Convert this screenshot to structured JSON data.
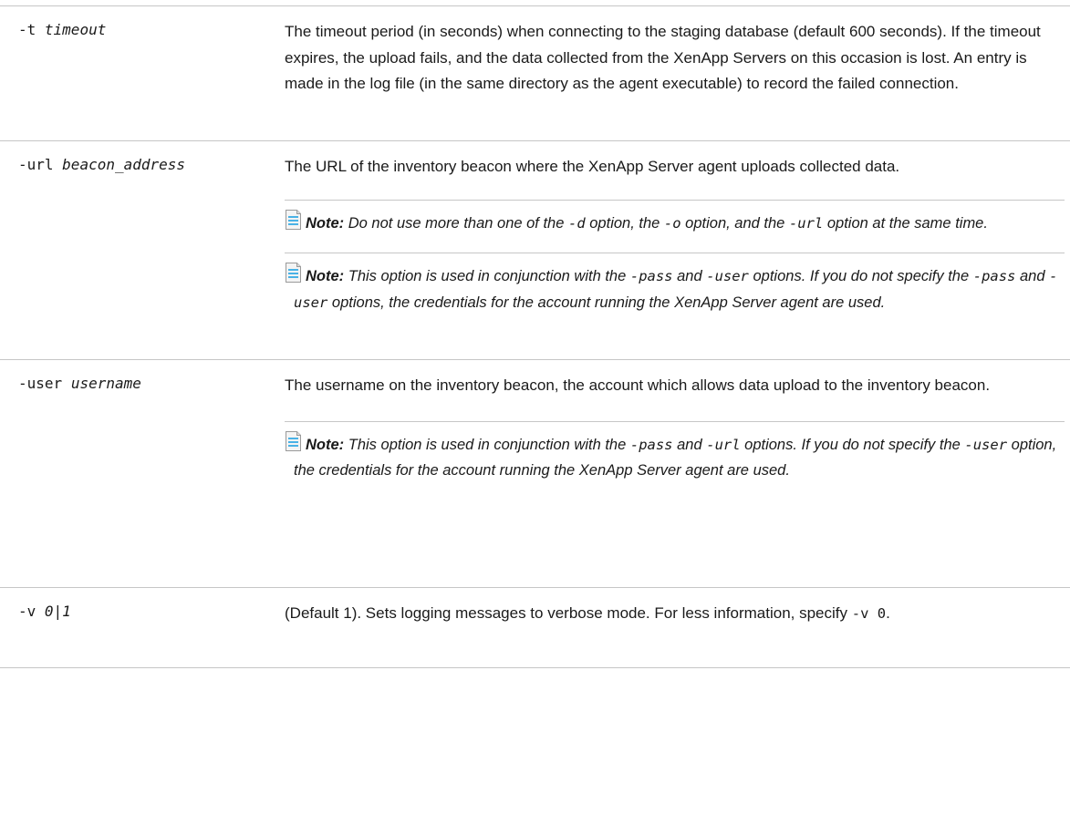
{
  "rows": [
    {
      "flag": "-t",
      "arg": "timeout",
      "desc": "The timeout period (in seconds) when connecting to the staging database (default 600 seconds). If the timeout expires, the upload fails, and the data collected from the XenApp Servers on this occasion is lost. An entry is made in the log file (in the same directory as the agent executable) to record the failed connection."
    },
    {
      "flag": "-url",
      "arg": "beacon_address",
      "desc": "The URL of the inventory beacon where the XenApp Server agent uploads collected data.",
      "notes": [
        {
          "label": "Note:",
          "t1": " Do not use more than one of the ",
          "c1": "-d",
          "t2": " option, the ",
          "c2": "-o",
          "t3": " option, and the ",
          "c3": "-url",
          "t4": " option at the same time."
        },
        {
          "label": "Note:",
          "t1": " This option is used in conjunction with the ",
          "c1": "-pass",
          "t2": " and ",
          "c2": "-user",
          "t3": " options. If you do not specify the ",
          "c3": "-pass",
          "t4": " and ",
          "c4": "-user",
          "t5": " options, the credentials for the account running the XenApp Server agent are used."
        }
      ]
    },
    {
      "flag": "-user",
      "arg": "username",
      "desc": "The username on the inventory beacon, the account which allows data upload to the inventory beacon.",
      "notes": [
        {
          "label": "Note:",
          "t1": " This option is used in conjunction with the ",
          "c1": "-pass",
          "t2": " and ",
          "c2": "-url",
          "t3": " options. If you do not specify the ",
          "c3": "-user",
          "t4": " option, the credentials for the account running the XenApp Server agent are used."
        }
      ]
    },
    {
      "flag": "-v",
      "arg": "0|1",
      "desc_1": "(Default 1). Sets logging messages to verbose mode. For less information, specify ",
      "desc_code": "-v 0",
      "desc_2": "."
    }
  ],
  "icons": {
    "note": "note-document-icon"
  },
  "colors": {
    "rule": "#c6c6c6",
    "icon_stripe": "#49b2e6"
  }
}
